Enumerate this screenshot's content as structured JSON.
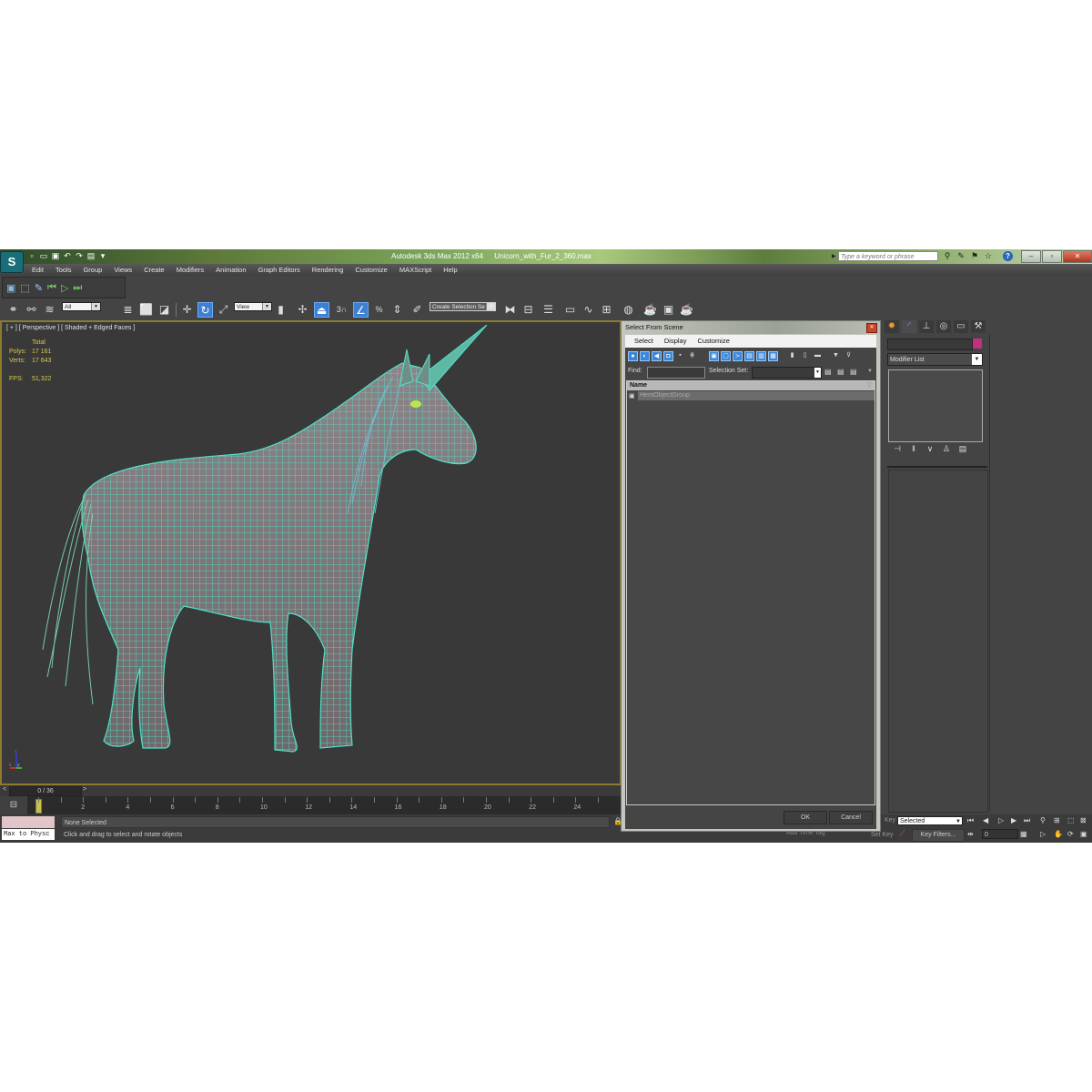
{
  "window": {
    "app_title": "Autodesk 3ds Max 2012 x64",
    "file_name": "Unicorn_with_Fur_2_360.max",
    "search_placeholder": "Type a keyword or phrase",
    "logo_glyph": "S"
  },
  "menu": [
    "Edit",
    "Tools",
    "Group",
    "Views",
    "Create",
    "Modifiers",
    "Animation",
    "Graph Editors",
    "Rendering",
    "Customize",
    "MAXScript",
    "Help"
  ],
  "main_toolbar": {
    "selection_filter": "All",
    "reference_coord": "View",
    "named_selection_placeholder": "Create Selection Se",
    "angle_snap_label": "3"
  },
  "viewport": {
    "label": "[ + ] [ Perspective ] [ Shaded + Edged Faces ]",
    "stats": {
      "header": "Total",
      "polys_label": "Polys:",
      "polys_value": "17 161",
      "verts_label": "Verts:",
      "verts_value": "17 643",
      "fps_label": "FPS:",
      "fps_value": "51,322"
    },
    "axis": {
      "x": "x",
      "y": "y",
      "z": "z"
    }
  },
  "timeline": {
    "frame_display": "0 / 36",
    "prev": "<",
    "next": ">",
    "current_frame": 0,
    "ticks": [
      "0",
      "2",
      "4",
      "6",
      "8",
      "10",
      "12",
      "14",
      "16",
      "18",
      "20",
      "22",
      "24"
    ]
  },
  "status": {
    "script_listener": "Max to Physc",
    "selection_status": "None Selected",
    "prompt": "Click and drag to select and rotate objects",
    "add_time_tag": "Add Time Tag",
    "auto_key": "Key",
    "set_key": "Set Key",
    "key_mode": "Selected",
    "key_filters": "Key Filters...",
    "current_frame_value": "0"
  },
  "command_panel": {
    "tabs": [
      "create",
      "modify",
      "hierarchy",
      "motion",
      "display",
      "utilities"
    ],
    "modifier_list": "Modifier List",
    "object_color": "#c2317d"
  },
  "dialog": {
    "title": "Select From Scene",
    "menu": [
      "Select",
      "Display",
      "Customize"
    ],
    "find_label": "Find:",
    "find_value": "",
    "selection_set_label": "Selection Set:",
    "column_header": "Name",
    "items": [
      "HeroObjectGroup"
    ],
    "ok": "OK",
    "cancel": "Cancel"
  },
  "colors": {
    "accent_blue": "#3c7fd3",
    "wireframe": "#4fe3c8",
    "viewport_border": "#8c7a2e",
    "stats_text": "#d9c94a"
  }
}
